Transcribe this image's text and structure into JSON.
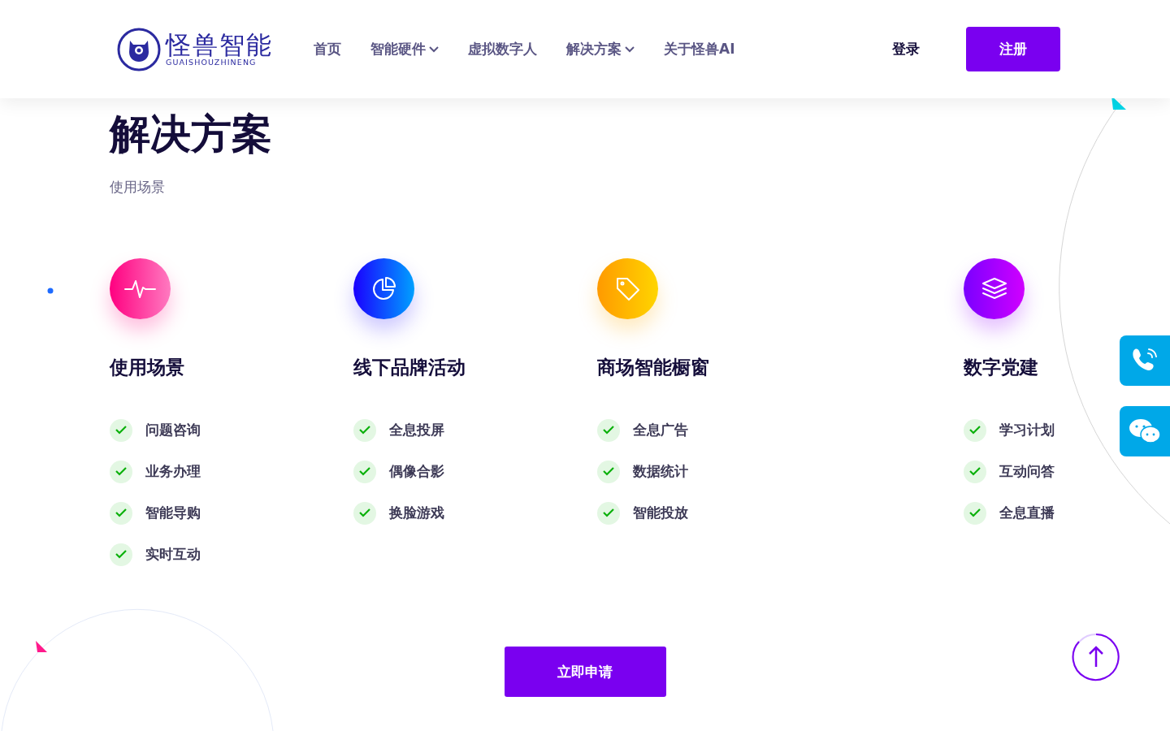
{
  "header": {
    "logo": {
      "name": "怪兽智能",
      "subtitle": "GUAISHOUZHINENG"
    },
    "nav": [
      {
        "label": "首页",
        "dropdown": false
      },
      {
        "label": "智能硬件",
        "dropdown": true
      },
      {
        "label": "虚拟数字人",
        "dropdown": false
      },
      {
        "label": "解决方案",
        "dropdown": true
      },
      {
        "label": "关于怪兽AI",
        "dropdown": false
      }
    ],
    "login": "登录",
    "register": "注册"
  },
  "page": {
    "title": "解决方案",
    "subtitle": "使用场景"
  },
  "solutions": [
    {
      "kind": "pulse",
      "title": "使用场景",
      "items": [
        "问题咨询",
        "业务办理",
        "智能导购",
        "实时互动"
      ]
    },
    {
      "kind": "pie",
      "title": "线下品牌活动",
      "items": [
        "全息投屏",
        "偶像合影",
        "换脸游戏"
      ]
    },
    {
      "kind": "tag",
      "title": "商场智能橱窗",
      "items": [
        "全息广告",
        "数据统计",
        "智能投放"
      ]
    },
    {
      "kind": "layers",
      "title": "数字党建",
      "items": [
        "学习计划",
        "互动问答",
        "全息直播"
      ]
    }
  ],
  "cta": "立即申请"
}
